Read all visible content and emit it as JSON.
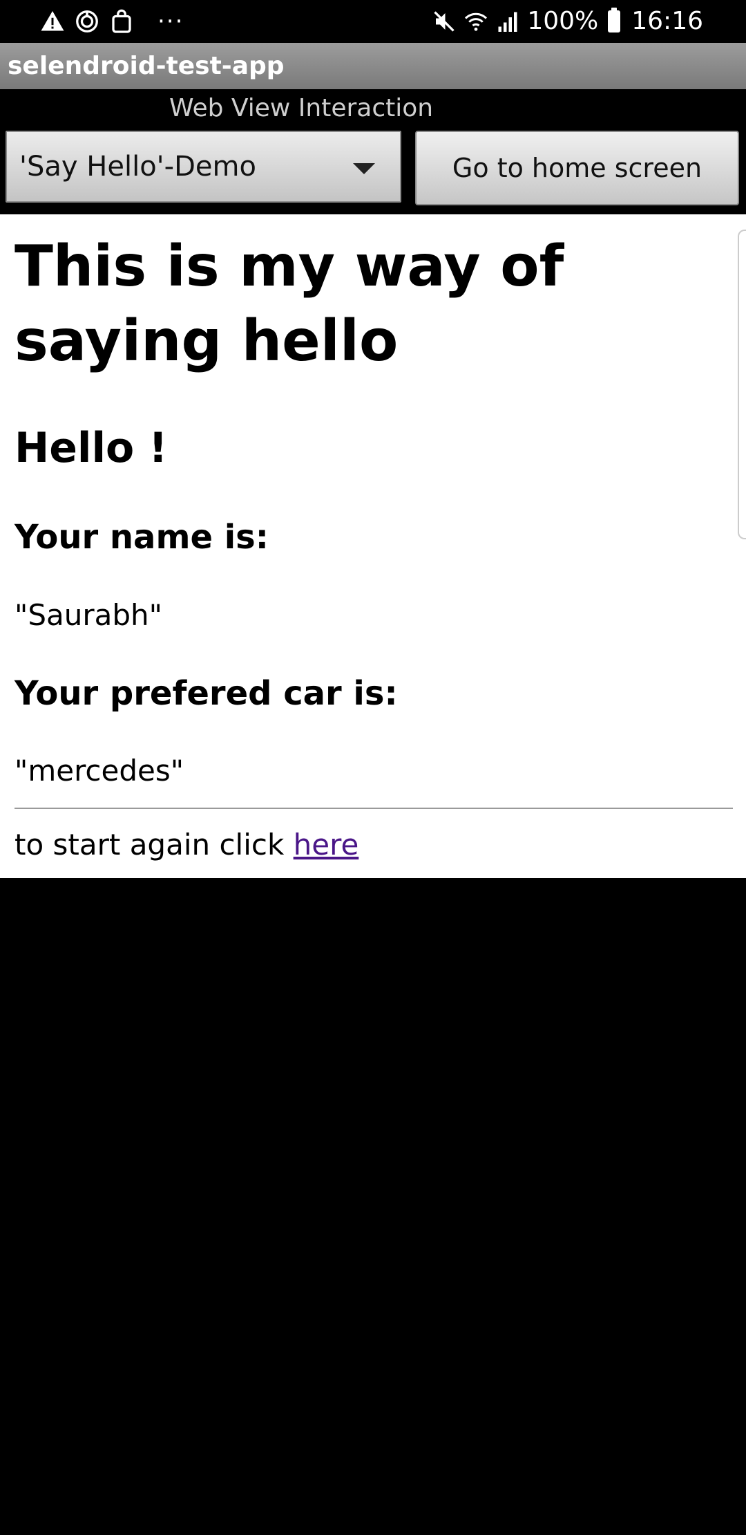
{
  "status_bar": {
    "left_icons": [
      "warning-icon",
      "sync-icon",
      "shopping-bag-icon"
    ],
    "overflow": "···",
    "right_icons": [
      "mute-icon",
      "wifi-icon",
      "signal-icon",
      "battery-icon"
    ],
    "battery_percent": "100%",
    "time": "16:16"
  },
  "app": {
    "title": "selendroid-test-app",
    "activity_label": "Web View Interaction"
  },
  "controls": {
    "spinner_value": "'Say Hello'-Demo",
    "home_button_label": "Go to home screen"
  },
  "webview": {
    "heading": "This is my way of saying hello",
    "greeting": "Hello !",
    "name_label": "Your name is:",
    "name_value": "\"Saurabh\"",
    "car_label": "Your prefered car is:",
    "car_value": "\"mercedes\"",
    "footer_text": "to start again click ",
    "footer_link": "here"
  },
  "colors": {
    "background": "#000000",
    "title_bar": "#8a8a8a",
    "link": "#4a1688",
    "webview_background": "#ffffff"
  }
}
